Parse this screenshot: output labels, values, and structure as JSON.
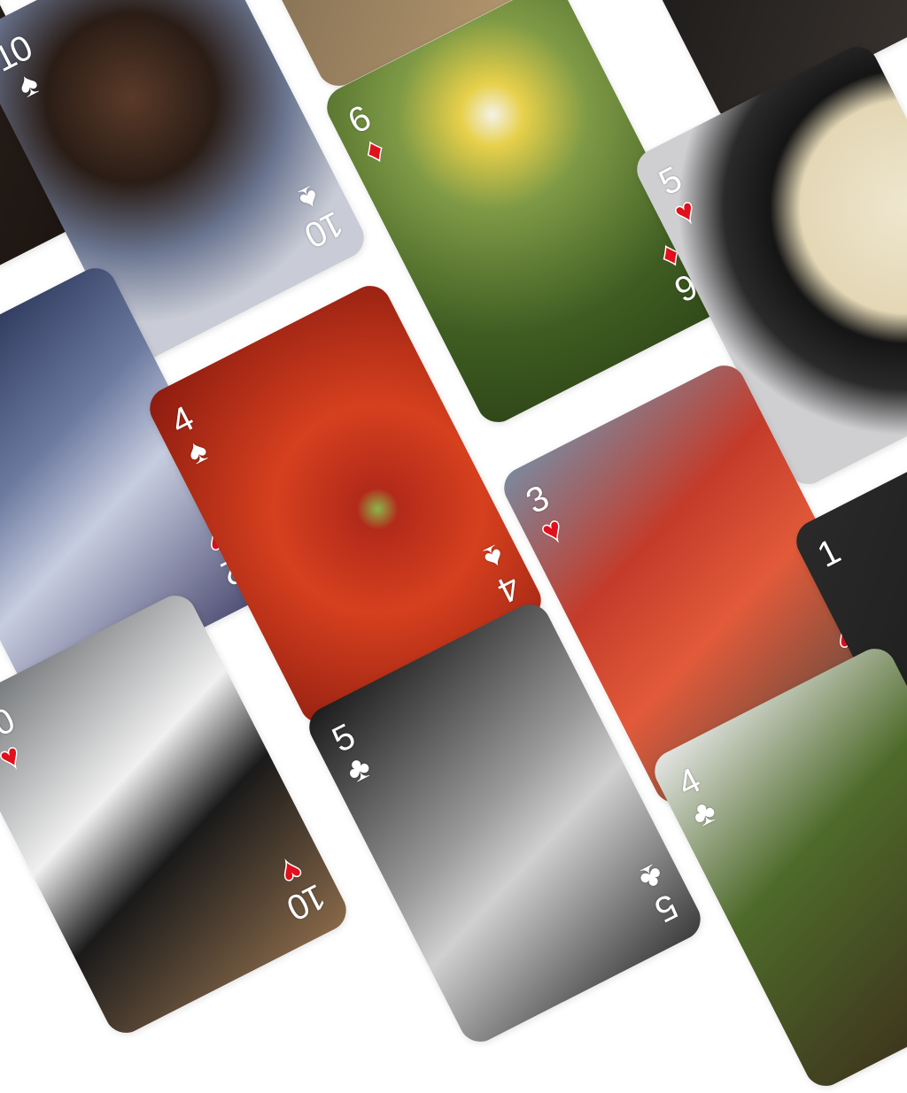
{
  "suit_glyphs": {
    "spades": "♠",
    "hearts": "♥",
    "diamonds": "♦",
    "clubs": "♣"
  },
  "colors": {
    "red_suit": "#e0101c",
    "text": "#ffffff",
    "background": "#ffffff"
  },
  "cards": [
    {
      "id": "top-left-dark",
      "rank": "",
      "suit": "",
      "photo": "dark partial photo",
      "bg": "linear-gradient(135deg,#3a2a22,#1a1410)"
    },
    {
      "id": "top-middle",
      "rank": "",
      "suit": "",
      "photo": "wooden surface",
      "bg": "linear-gradient(135deg,#6b5a45,#b79a70)"
    },
    {
      "id": "top-right",
      "rank": "",
      "suit": "",
      "photo": "dark grille",
      "bg": "linear-gradient(135deg,#111,#3a3430)"
    },
    {
      "id": "girl-books",
      "rank": "10",
      "suit": "spades",
      "photo": "girl with chemistry books",
      "bg": "radial-gradient(circle at 45% 35%,#5a3a28 0,#2a1d16 30%,#6a7590 55%,#c9ccd6 80%)"
    },
    {
      "id": "daisy",
      "rank": "6",
      "suit": "diamonds",
      "photo": "daisy flowers",
      "bg": "radial-gradient(circle at 55% 25%,#f4f2e8 0,#e7d04a 10%,#7f9a46 30%,#3f5d22 70%,#2f4618 100%)"
    },
    {
      "id": "clock",
      "rank": "5",
      "suit": "hearts",
      "photo": "vintage wall clock",
      "bg": "radial-gradient(circle at 85% 45%,#efe6cf 0,#e3d7b5 35%,#151515 45%,#2a2a2a 60%,#cfcfd2 75%)"
    },
    {
      "id": "concert",
      "rank": "2",
      "suit": "hearts",
      "photo": "singer on stage",
      "bg": "linear-gradient(160deg,#1a2548 0,#6d7aa0 40%,#c7cde0 60%,#4a4a70 100%)"
    },
    {
      "id": "tomatoes",
      "rank": "4",
      "suit": "spades",
      "photo": "pile of tomatoes",
      "bg": "radial-gradient(circle at 60% 55%,#8bb54a 0,#b32a1a 8%,#d6401e 40%,#8a1a10 100%)"
    },
    {
      "id": "kids",
      "rank": "3",
      "suit": "hearts",
      "photo": "two children in red",
      "bg": "linear-gradient(160deg,#7a8aa0 0,#c43b2a 35%,#e25a3a 60%,#5a4a40 100%)"
    },
    {
      "id": "partial-right",
      "rank": "1",
      "suit": "",
      "photo": "dark partial photo",
      "bg": "linear-gradient(135deg,#2a2a2a,#111)"
    },
    {
      "id": "panda",
      "rank": "10",
      "suit": "hearts",
      "photo": "panda on a branch",
      "bg": "linear-gradient(160deg,#6a6d70 0,#f0f0f0 40%,#1a1a1a 60%,#8a6a4a 100%)"
    },
    {
      "id": "girl-face",
      "rank": "5",
      "suit": "clubs",
      "photo": "black and white portrait",
      "bg": "linear-gradient(160deg,#1a1a1a 0,#9a9a9a 45%,#d0d0d0 60%,#3a3a3a 100%)"
    },
    {
      "id": "boy-grass",
      "rank": "4",
      "suit": "clubs",
      "photo": "child on grass",
      "bg": "linear-gradient(160deg,#e7e7e7 0,#4e6a2a 40%,#3a2a1a 100%)"
    }
  ]
}
